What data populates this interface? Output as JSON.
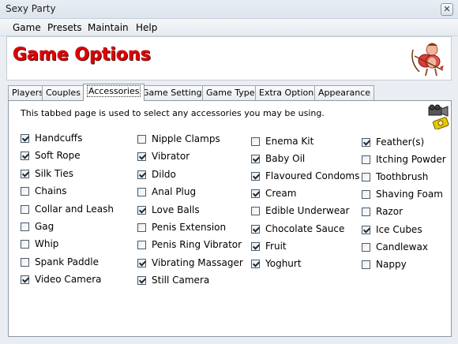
{
  "window": {
    "title": "Sexy Party",
    "close_glyph": "✕"
  },
  "menu": [
    "Game",
    "Presets",
    "Maintain",
    "Help"
  ],
  "header": {
    "title": "Game Options",
    "mascot_icon": "cupid-icon"
  },
  "tabs": [
    {
      "label": "Players",
      "active": false
    },
    {
      "label": "Couples",
      "active": false
    },
    {
      "label": "Accessories",
      "active": true
    },
    {
      "label": "Game Settings",
      "active": false
    },
    {
      "label": "Game Type",
      "active": false
    },
    {
      "label": "Extra Options",
      "active": false
    },
    {
      "label": "Appearance",
      "active": false
    }
  ],
  "panel": {
    "description": "This tabbed page is used to select any accessories you may be using.",
    "side_icons": [
      "video-camera-icon",
      "still-camera-icon"
    ]
  },
  "columns": [
    [
      {
        "label": "Handcuffs",
        "checked": true
      },
      {
        "label": "Soft Rope",
        "checked": true
      },
      {
        "label": "Silk Ties",
        "checked": true
      },
      {
        "label": "Chains",
        "checked": false
      },
      {
        "label": "Collar and Leash",
        "checked": false
      },
      {
        "label": "Gag",
        "checked": false
      },
      {
        "label": "Whip",
        "checked": false
      },
      {
        "label": "Spank Paddle",
        "checked": false
      },
      {
        "label": "Video Camera",
        "checked": true
      }
    ],
    [
      {
        "label": "Nipple Clamps",
        "checked": false
      },
      {
        "label": "Vibrator",
        "checked": true
      },
      {
        "label": "Dildo",
        "checked": true
      },
      {
        "label": "Anal Plug",
        "checked": false
      },
      {
        "label": "Love Balls",
        "checked": true
      },
      {
        "label": "Penis Extension",
        "checked": false
      },
      {
        "label": "Penis Ring Vibrator",
        "checked": false
      },
      {
        "label": "Vibrating Massager",
        "checked": true
      },
      {
        "label": "Still Camera",
        "checked": true
      }
    ],
    [
      {
        "label": "Enema Kit",
        "checked": false
      },
      {
        "label": "Baby Oil",
        "checked": true
      },
      {
        "label": "Flavoured Condoms",
        "checked": true
      },
      {
        "label": "Cream",
        "checked": true
      },
      {
        "label": "Edible Underwear",
        "checked": false
      },
      {
        "label": "Chocolate Sauce",
        "checked": true
      },
      {
        "label": "Fruit",
        "checked": true
      },
      {
        "label": "Yoghurt",
        "checked": true
      }
    ],
    [
      {
        "label": "Feather(s)",
        "checked": true
      },
      {
        "label": "Itching Powder",
        "checked": false
      },
      {
        "label": "Toothbrush",
        "checked": false
      },
      {
        "label": "Shaving Foam",
        "checked": false
      },
      {
        "label": "Razor",
        "checked": false
      },
      {
        "label": "Ice Cubes",
        "checked": true
      },
      {
        "label": "Candlewax",
        "checked": false
      },
      {
        "label": "Nappy",
        "checked": false
      }
    ]
  ]
}
